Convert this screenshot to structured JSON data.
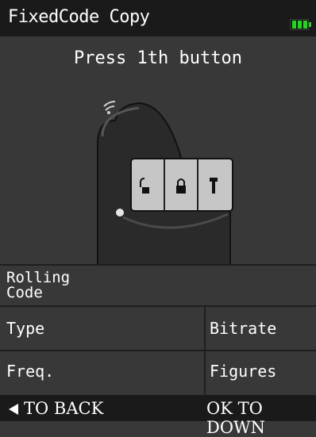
{
  "header": {
    "title": "FixedCode Copy",
    "battery_icon": "battery-full-icon",
    "battery_level": 1.0,
    "battery_color": "#22d622"
  },
  "main": {
    "prompt": "Press 1th button",
    "remote_icon": "car-remote-key-icon",
    "remote_buttons": [
      "lock-open-icon",
      "lock-closed-icon",
      "trunk-icon"
    ]
  },
  "info": {
    "rolling_code_label": "Rolling\nCode",
    "type_label": "Type",
    "bitrate_label": "Bitrate",
    "freq_label": "Freq.",
    "figures_label": "Figures"
  },
  "footer": {
    "back_icon": "triangle-left-icon",
    "back_label": "TO BACK",
    "ok_label": "OK TO DOWN"
  }
}
